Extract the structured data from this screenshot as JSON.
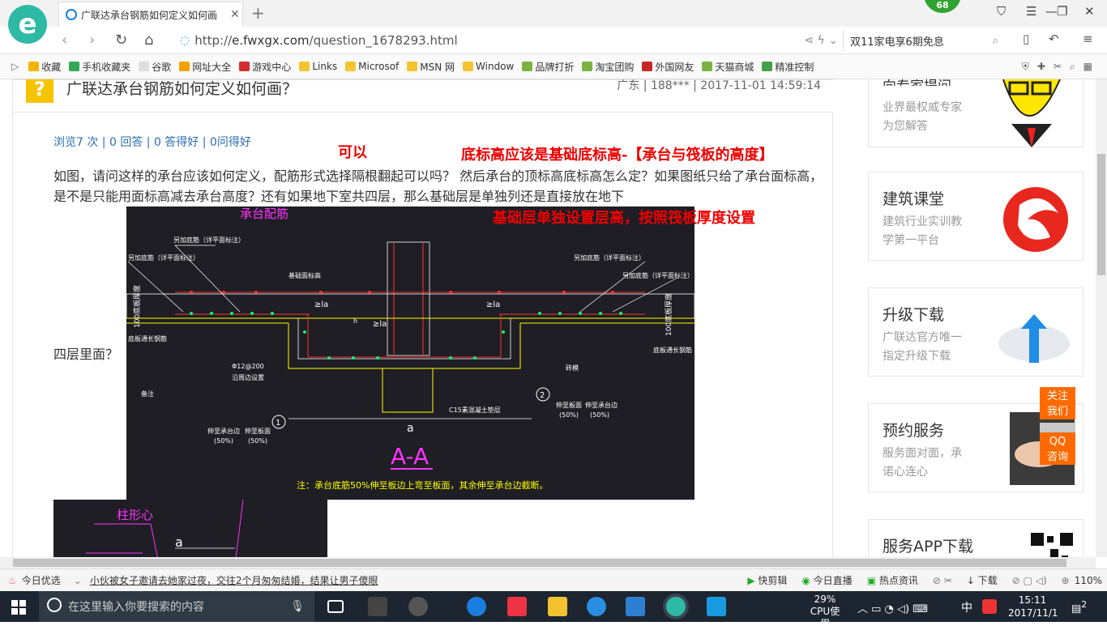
{
  "browser": {
    "tab_title": "广联达承台钢筋如何定义如何画",
    "tab_close": "✕",
    "new_tab": "+",
    "badge_count": "68",
    "url_prefix": "http://",
    "url_domain": "e.fwxgx.com",
    "url_path": "/question_1678293.html",
    "search_text": "双11家电享6期免息"
  },
  "bookmarks": [
    {
      "label": "收藏",
      "color": "#f4b400"
    },
    {
      "label": "手机收藏夹",
      "color": "#34a853"
    },
    {
      "label": "谷歌",
      "color": "#dddddd"
    },
    {
      "label": "网址大全",
      "color": "#f4a100"
    },
    {
      "label": "游戏中心",
      "color": "#d32f2f"
    },
    {
      "label": "Links",
      "color": "#f4c430"
    },
    {
      "label": "Microsof",
      "color": "#f4c430"
    },
    {
      "label": "MSN 网",
      "color": "#f4c430"
    },
    {
      "label": "Window",
      "color": "#f4c430"
    },
    {
      "label": "品牌打折",
      "color": "#7cb342"
    },
    {
      "label": "淘宝团购",
      "color": "#7cb342"
    },
    {
      "label": "外国网友",
      "color": "#c62828"
    },
    {
      "label": "天猫商城",
      "color": "#7cb342"
    },
    {
      "label": "精准控制",
      "color": "#43a047"
    }
  ],
  "question": {
    "title": "广联达承台钢筋如何定义如何画？",
    "meta": "广东 | 188*** | 2017-11-01 14:59:14",
    "stats": "浏览7 次 | 0 回答 | 0 答得好 | 0问得好",
    "body": "如图，请问这样的承台应该如何定义，配筋形式选择隔根翻起可以吗？  然后承台的顶标高底标高怎么定？如果图纸只给了承台面标高，是不是只能用面标高减去承台高度？还有如果地下室共四层，那么基础层是单独列还是直接放在地下",
    "body_cont": "四层里面？"
  },
  "annotations": {
    "a1": "可以",
    "a2": "底标高应该是基础底标高-【承台与筏板的高度】",
    "a3": "基础层单独设置层高，按照筏板厚度设置"
  },
  "cad": {
    "title": "承台配筋",
    "section": "A-A",
    "dim_a": "a",
    "note": "注：承台底筋50%伸至板边上弯至板面，其余伸至承台边截断。",
    "label_left1": "另加底筋（详平面标注）",
    "label_left2": "另加底筋（详平面标注）",
    "label_base": "基础面标高",
    "label_right1": "另加底筋（详平面标注）",
    "label_right2": "另加底筋（详平面标注）",
    "label_la": "≥la",
    "label_lower_left": "底板通长钢筋",
    "label_lower_right": "底板通长钢筋",
    "label_stir": "Φ12@200",
    "label_stir2": "沿周边设置",
    "label_beam": "砖模",
    "label_c15": "C15素混凝土垫层",
    "label_bei": "备注",
    "dim_left": "100底板厚度",
    "dim_right": "100底板厚度",
    "sub1": "伸至承台边",
    "sub1b": "(50%)",
    "sub2": "伸至板面",
    "sub2b": "(50%)",
    "sub3": "伸至板面",
    "sub3b": "(50%)",
    "sub4": "伸至承台边",
    "sub4b": "(50%)",
    "circ1": "1",
    "circ2": "2",
    "lower_title": "柱形心",
    "lower_a": "a",
    "h_label": "h"
  },
  "sidebar": {
    "top_line1": "向专家提问",
    "top_line2": "业界最权威专家",
    "top_line3": "为您解答",
    "cards": [
      {
        "title": "建筑课堂",
        "desc1": "建筑行业实训教",
        "desc2": "学第一平台"
      },
      {
        "title": "升级下载",
        "desc1": "广联达官方唯一",
        "desc2": "指定升级下载"
      },
      {
        "title": "预约服务",
        "desc1": "服务面对面，承",
        "desc2": "诺心连心"
      },
      {
        "title": "服务APP下载",
        "desc1": "",
        "desc2": ""
      }
    ],
    "float_follow": "关注我们",
    "float_qq": "QQ咨询",
    "to_top": "︿"
  },
  "statusbar": {
    "left": "今日优选",
    "news": "小伙被女子邀请去她家过夜，交往2个月匆匆结婚，结果让男子傻眼",
    "s1": "快剪辑",
    "s2": "今日直播",
    "s3": "热点资讯",
    "s4": "下载",
    "zoom": "110%"
  },
  "taskbar": {
    "search_placeholder": "在这里输入你要搜索的内容",
    "cpu_pct": "29%",
    "cpu_label": "CPU使用",
    "ime": "中",
    "time": "15:11",
    "date": "2017/11/1",
    "notif": "2"
  }
}
